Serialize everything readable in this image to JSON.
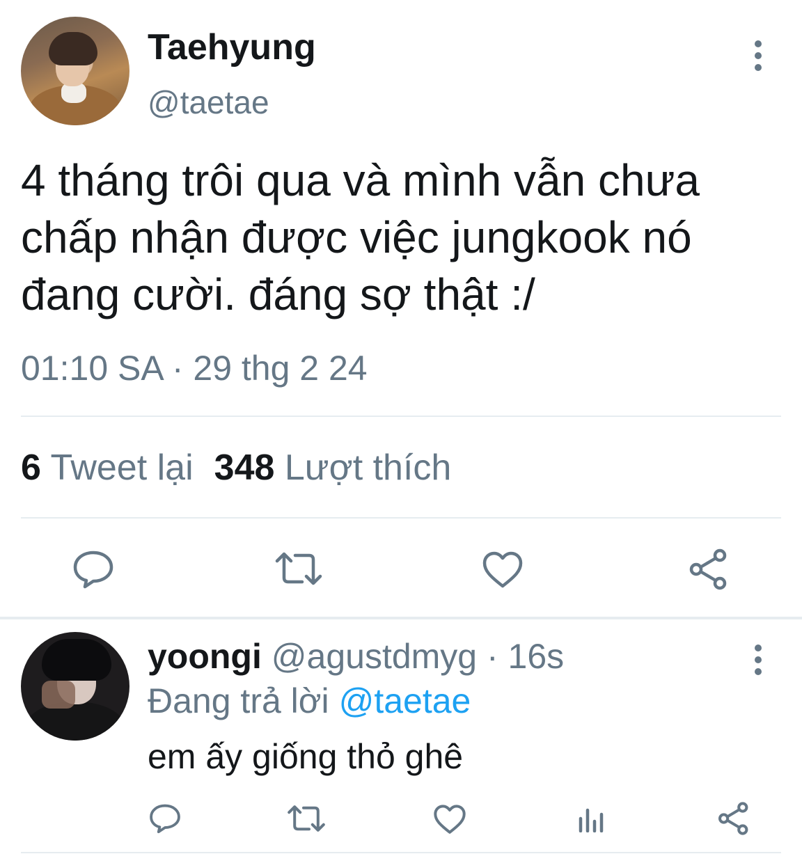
{
  "tweet": {
    "display_name": "Taehyung",
    "handle": "@taetae",
    "text": "4 tháng trôi qua và mình vẫn chưa chấp nhận được việc jungkook nó đang cười. đáng sợ thật :/",
    "timestamp": "01:10 SA · 29 thg 2 24",
    "retweet_count": "6",
    "retweet_label": "Tweet lại",
    "like_count": "348",
    "like_label": "Lượt thích",
    "actions": [
      "reply-icon",
      "retweet-icon",
      "heart-icon",
      "share-icon"
    ],
    "more_icon": "more-vertical-icon"
  },
  "reply": {
    "display_name": "yoongi",
    "handle_time": "@agustdmyg · 16s",
    "replying_to_label": "Đang trả lời",
    "replying_to_mention": "@taetae",
    "text": "em ấy giống thỏ ghê",
    "actions": [
      "reply-icon",
      "retweet-icon",
      "heart-icon",
      "analytics-icon",
      "share-icon"
    ],
    "more_icon": "more-vertical-icon"
  },
  "colors": {
    "text_primary": "#14171a",
    "text_secondary": "#657786",
    "mention_blue": "#1da1f2",
    "divider": "#e6ecf0"
  }
}
